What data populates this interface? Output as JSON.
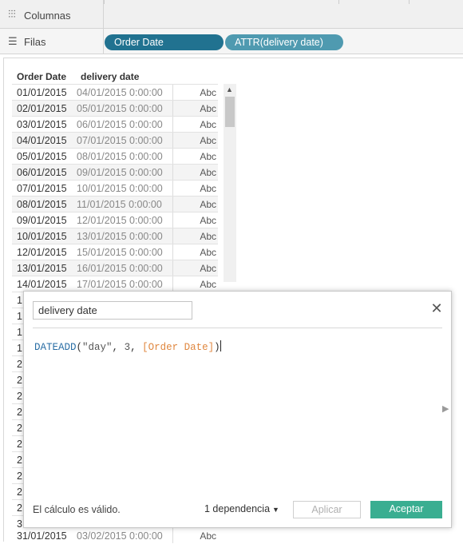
{
  "shelves": {
    "columns_label": "Columnas",
    "rows_label": "Filas",
    "pills": [
      "Order Date",
      "ATTR(delivery date)"
    ]
  },
  "table": {
    "headers": [
      "Order Date",
      "delivery date"
    ],
    "rows": [
      {
        "order": "01/01/2015",
        "delivery": "04/01/2015 0:00:00",
        "type": "Abc"
      },
      {
        "order": "02/01/2015",
        "delivery": "05/01/2015 0:00:00",
        "type": "Abc"
      },
      {
        "order": "03/01/2015",
        "delivery": "06/01/2015 0:00:00",
        "type": "Abc"
      },
      {
        "order": "04/01/2015",
        "delivery": "07/01/2015 0:00:00",
        "type": "Abc"
      },
      {
        "order": "05/01/2015",
        "delivery": "08/01/2015 0:00:00",
        "type": "Abc"
      },
      {
        "order": "06/01/2015",
        "delivery": "09/01/2015 0:00:00",
        "type": "Abc"
      },
      {
        "order": "07/01/2015",
        "delivery": "10/01/2015 0:00:00",
        "type": "Abc"
      },
      {
        "order": "08/01/2015",
        "delivery": "11/01/2015 0:00:00",
        "type": "Abc"
      },
      {
        "order": "09/01/2015",
        "delivery": "12/01/2015 0:00:00",
        "type": "Abc"
      },
      {
        "order": "10/01/2015",
        "delivery": "13/01/2015 0:00:00",
        "type": "Abc"
      },
      {
        "order": "12/01/2015",
        "delivery": "15/01/2015 0:00:00",
        "type": "Abc"
      },
      {
        "order": "13/01/2015",
        "delivery": "16/01/2015 0:00:00",
        "type": "Abc"
      },
      {
        "order": "14/01/2015",
        "delivery": "17/01/2015 0:00:00",
        "type": "Abc"
      }
    ],
    "hidden_row_stubs": [
      "1",
      "1",
      "1",
      "1",
      "2",
      "2",
      "2",
      "2",
      "2",
      "2",
      "2",
      "2",
      "2",
      "2",
      "3"
    ],
    "last_row": {
      "order": "31/01/2015",
      "delivery": "03/02/2015 0:00:00",
      "type": "Abc"
    }
  },
  "dialog": {
    "calc_name": "delivery date",
    "formula": {
      "fn": "DATEADD",
      "open": "(",
      "arg1": "\"day\"",
      "sep1": ", ",
      "arg2": "3",
      "sep2": ", ",
      "field": "[Order Date]",
      "close": ")"
    },
    "status": "El cálculo es válido.",
    "dependency_label": "1 dependencia",
    "apply_label": "Aplicar",
    "accept_label": "Aceptar"
  },
  "icons": {
    "columns": "columns-icon",
    "rows": "rows-icon",
    "close": "close-icon",
    "dropdown": "caret-down-icon",
    "expand": "expand-right-icon"
  },
  "colors": {
    "pill_dimension": "#217290",
    "pill_attr": "#4f9ab0",
    "accept": "#3aae91",
    "function": "#2a6ea5",
    "field": "#e0873f"
  }
}
